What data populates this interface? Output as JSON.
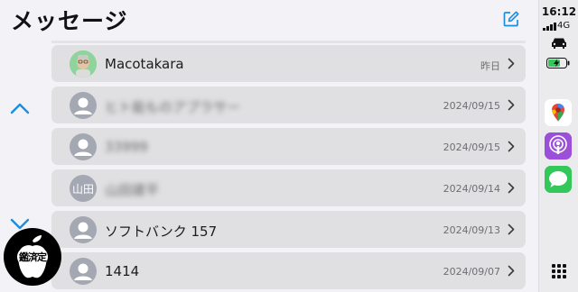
{
  "header": {
    "title": "メッセージ"
  },
  "conversations": [
    {
      "name": "Macotakara",
      "date": "昨日",
      "avatar": "memoji",
      "initials": "",
      "blurred": false
    },
    {
      "name": "ヒト能ものアプラサー",
      "date": "2024/09/15",
      "avatar": "person",
      "initials": "",
      "blurred": true
    },
    {
      "name": "33999",
      "date": "2024/09/15",
      "avatar": "person",
      "initials": "",
      "blurred": true
    },
    {
      "name": "山田建平",
      "date": "2024/09/14",
      "avatar": "initials",
      "initials": "山田",
      "blurred": true
    },
    {
      "name": "ソフトバンク 157",
      "date": "2024/09/13",
      "avatar": "person",
      "initials": "",
      "blurred": false
    },
    {
      "name": "1414",
      "date": "2024/09/07",
      "avatar": "person",
      "initials": "",
      "blurred": false
    }
  ],
  "status": {
    "time": "16:12",
    "network": "4G"
  },
  "dock_apps": [
    {
      "name": "google-maps",
      "color": "#ffffff"
    },
    {
      "name": "podcasts",
      "color": "#9c4fd9"
    },
    {
      "name": "messages",
      "color": "#34c759"
    }
  ],
  "watermark": {
    "text": "鑑済定",
    "color": "#000000"
  },
  "colors": {
    "accent": "#1a8fe0",
    "row": "#e0e0e2",
    "background": "#f2f2f7"
  }
}
